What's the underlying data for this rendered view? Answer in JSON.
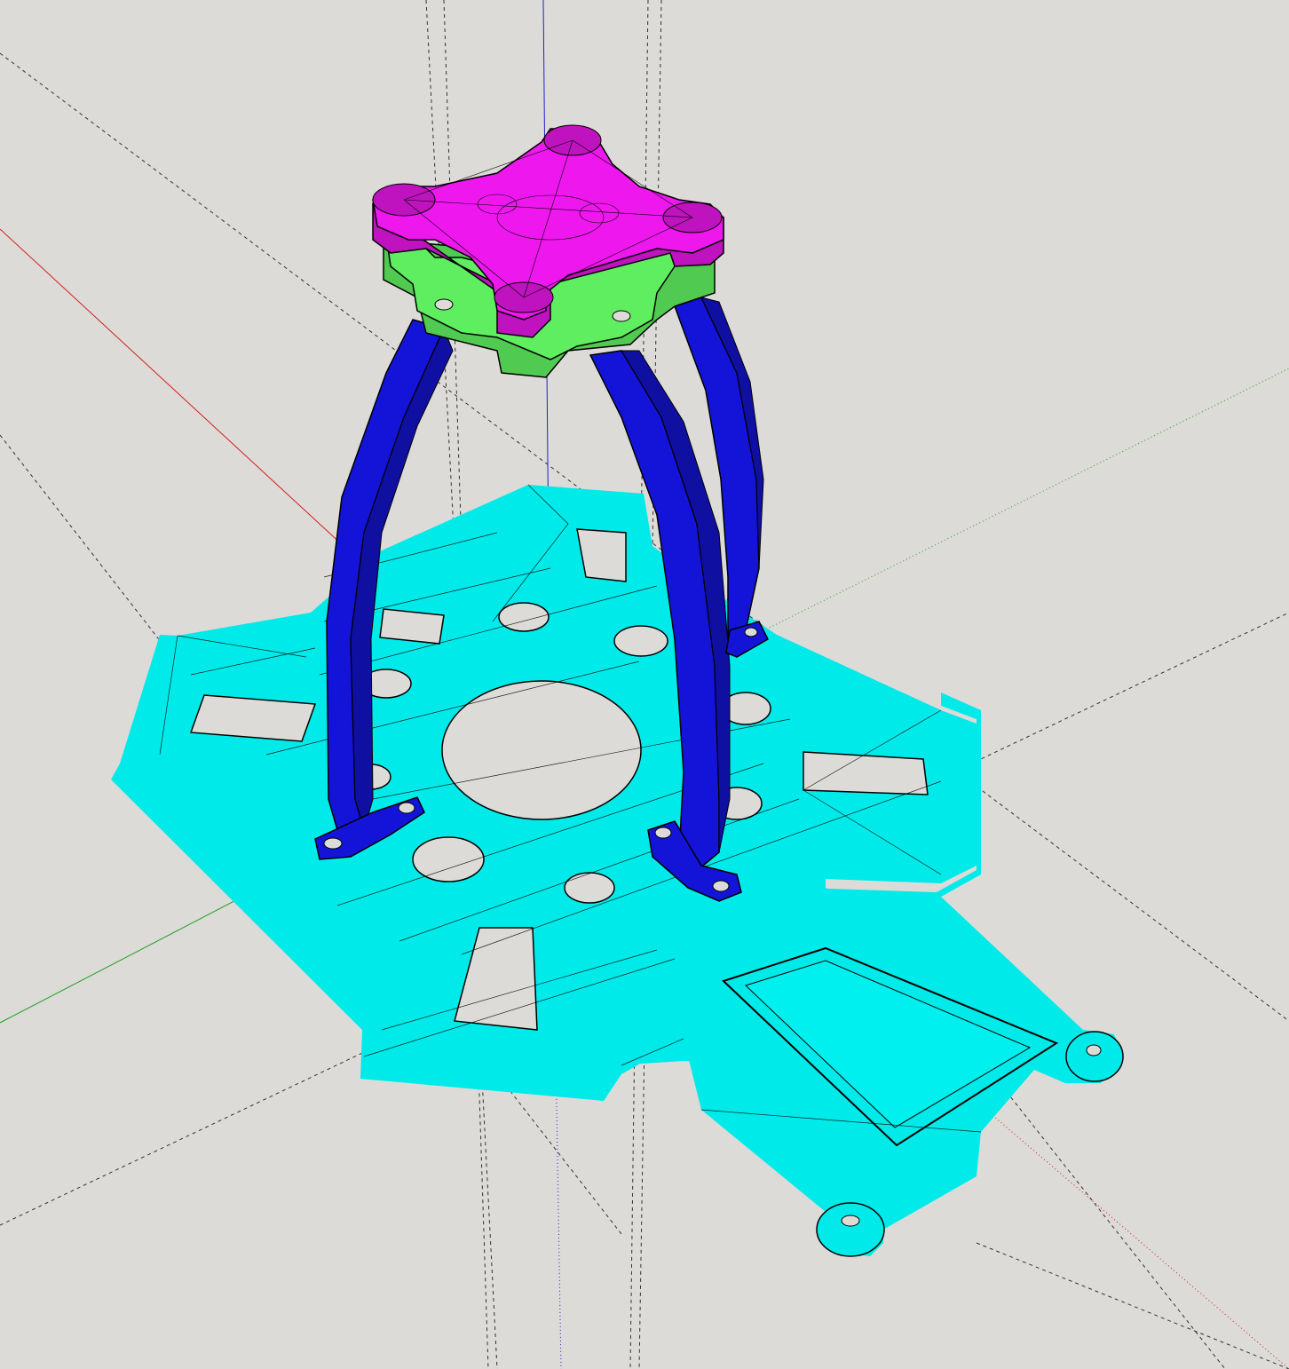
{
  "viewport": {
    "background": "#dcdbd7",
    "model": "quadcopter-frame-assembly"
  },
  "axes": {
    "red_axis_color": "#d02020",
    "green_axis_color": "#20a020",
    "blue_axis_color": "#2020d0"
  },
  "parts": {
    "top_plate_color": "#ee18ee",
    "spacer_plate_color": "#5fee5f",
    "legs_color": "#1414d8",
    "frame_plate_color": "#00eaea",
    "edge_color": "#0a0a0a"
  }
}
